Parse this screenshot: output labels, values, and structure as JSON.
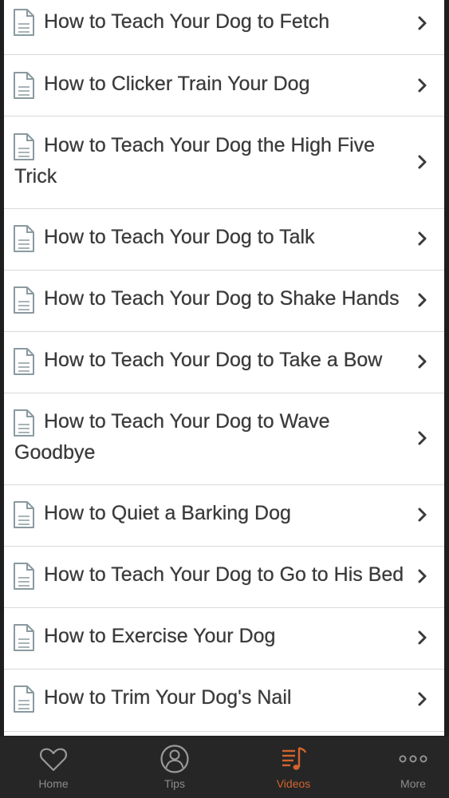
{
  "list": {
    "items": [
      {
        "title": "How to Teach Your Dog to Fetch"
      },
      {
        "title": "How to Clicker Train Your Dog"
      },
      {
        "title": "How to Teach Your Dog the High Five Trick"
      },
      {
        "title": "How to Teach Your Dog to Talk"
      },
      {
        "title": "How to Teach Your Dog to Shake Hands"
      },
      {
        "title": "How to Teach Your Dog to Take a Bow"
      },
      {
        "title": "How to Teach Your Dog to Wave Goodbye"
      },
      {
        "title": "How to Quiet a Barking Dog"
      },
      {
        "title": "How to Teach Your Dog to Go to His Bed"
      },
      {
        "title": "How to Exercise Your Dog"
      },
      {
        "title": "How to Trim Your Dog's Nail"
      }
    ]
  },
  "tabbar": {
    "tabs": [
      {
        "label": "Home",
        "icon": "heart-icon"
      },
      {
        "label": "Tips",
        "icon": "user-circle-icon"
      },
      {
        "label": "Videos",
        "icon": "playlist-music-icon",
        "active": true
      },
      {
        "label": "More",
        "icon": "more-dots-icon"
      }
    ]
  },
  "colors": {
    "accent": "#d2642d",
    "tabbar_background": "#262626",
    "text": "#3a3a3a"
  }
}
